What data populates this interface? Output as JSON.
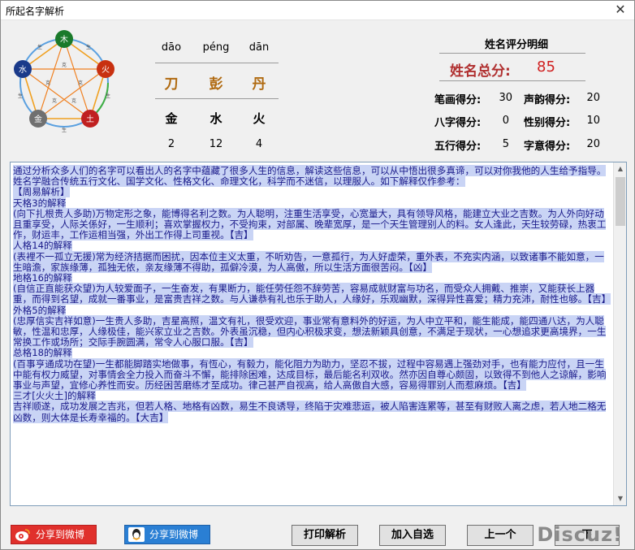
{
  "window": {
    "title": "所起名字解析",
    "close_glyph": "✕"
  },
  "wheel": {
    "labels": [
      "木",
      "火",
      "土",
      "金",
      "水"
    ],
    "inner": [
      "生",
      "生",
      "生",
      "生",
      "生",
      "克",
      "克",
      "克",
      "克",
      "克"
    ]
  },
  "name": {
    "chars": [
      {
        "pinyin": "dāo",
        "char": "刀",
        "element": "金",
        "strokes": "2"
      },
      {
        "pinyin": "péng",
        "char": "彭",
        "element": "水",
        "strokes": "12"
      },
      {
        "pinyin": "dān",
        "char": "丹",
        "element": "火",
        "strokes": "4"
      }
    ]
  },
  "score": {
    "header": "姓名评分明细",
    "total_label": "姓名总分:",
    "total_value": "85",
    "items": [
      {
        "label": "笔画得分:",
        "value": "30"
      },
      {
        "label": "声韵得分:",
        "value": "20"
      },
      {
        "label": "八字得分:",
        "value": "0"
      },
      {
        "label": "性别得分:",
        "value": "10"
      },
      {
        "label": "五行得分:",
        "value": "5"
      },
      {
        "label": "字意得分:",
        "value": "20"
      }
    ]
  },
  "analysis": {
    "intro": "通过分析众多人们的名字可以看出人的名字中蕴藏了很多人生的信息，解读这些信息，可以从中悟出很多真谛，可以对你我他的人生给予指导。姓名学融合传统五行文化、国学文化、性格文化、命理文化，科学而不迷信，以理服人。如下解释仅作参考：",
    "sections": [
      {
        "title": "【周易解析】",
        "sub": "天格3的解释",
        "body": "(向下扎根贵人多助)万物定形之象，能博得名利之数。为人聪明，注重生活享受，心宽量大，具有领导风格，能建立大业之吉数。为人外向好动且重享受，人际关係好，一生顺利；喜欢掌握权力，不受拘束，对部属、晚辈宽厚，是一个天生管理别人的料。女人逢此，天生较劳碌，热衷工作，财运丰，工作运相当强，外出工作得上司重视。【吉】"
      },
      {
        "title": "",
        "sub": "人格14的解释",
        "body": "(表裡不一孤立无援)常为经济拮据而困扰，因本位主义太重，不听劝告，一意孤行，为人好虚荣，重外表，不充实内涵，以致诸事不能如意，一生暗澹，家族缘薄，孤独无依，亲友缘薄不得助，孤僻冷漠，为人高傲，所以生活方面很苦闷。【凶】"
      },
      {
        "title": "",
        "sub": "地格16的解释",
        "body": "(自信正直能获众望)为人较爱面子，一生奋发，有果断力，能任劳任怨不辞劳苦，容易成就财富与功名，而受众人拥戴、推崇，又能获长上器重，而得到名望，成就一番事业，是富贵吉祥之数。与人谦恭有礼也乐于助人，人缘好，乐观幽默，深得异性喜爱；精力充沛，耐性也够。【吉】"
      },
      {
        "title": "",
        "sub": "外格5的解释",
        "body": "(忠厚信实吉祥如意)一生贵人多助，吉星高照，温文有礼，很受欢迎，事业常有意料外的好运，为人中立平和，能生能成，能四通八达，为人聪敏，性温和忠厚，人缘极佳，能兴家立业之吉数。外表虽沉稳，但内心积极求变，想法新颖具创意，不满足于现状，一心想追求更高境界，一生常换工作或场所；交际手腕圆满，常令人心服口服。【吉】"
      },
      {
        "title": "",
        "sub": "总格18的解释",
        "body": "(百事亨通成功在望)一生都能脚踏实地做事，有恆心，有毅力，能化阻力为助力，坚忍不拔，过程中容易遇上强劲对手，也有能力应付，且一生中能有权力威望，对事情会全力投入而奋斗不懈，能排除困难，达成目标，最后能名利双收。然亦因自尊心颇固，以致得不到他人之谅解，影响事业与声望，宜修心养性而安。历经困苦磨练才至成功。律己甚严自视高，给人高傲自大感，容易得罪别人而惹麻烦。【吉】"
      },
      {
        "title": "",
        "sub": "三才[火火土]的解释",
        "body": "吉祥顺遂，成功发展之吉兆，但若人格、地格有凶数，易生不良诱导，终陷于灾难悲运，被人陷害连累等，甚至有财败人离之虑，若人地二格无凶数，则大体是长寿幸福的。【大吉】"
      }
    ]
  },
  "buttons": {
    "share_weibo": "分享到微博",
    "share_qq": "分享到微博",
    "print": "打印解析",
    "add": "加入自选",
    "prev": "上一个",
    "next": "下"
  },
  "watermark": "Discuz!",
  "colors": {
    "accent_red": "#d02020",
    "text_blue": "#1a1a8a",
    "highlight": "#c9d4f5"
  }
}
